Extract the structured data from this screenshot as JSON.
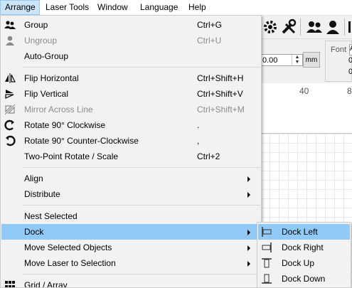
{
  "menubar": {
    "items": [
      {
        "label": "Arrange"
      },
      {
        "label": "Laser Tools"
      },
      {
        "label": "Window"
      },
      {
        "label": "Language"
      },
      {
        "label": "Help"
      }
    ]
  },
  "arrange_menu": {
    "items": [
      {
        "label": "Group",
        "shortcut": "Ctrl+G",
        "icon": "group-icon"
      },
      {
        "label": "Ungroup",
        "shortcut": "Ctrl+U",
        "icon": "ungroup-icon",
        "disabled": true
      },
      {
        "label": "Auto-Group",
        "shortcut": ""
      },
      {
        "label": "Flip Horizontal",
        "shortcut": "Ctrl+Shift+H",
        "icon": "flip-horizontal-icon"
      },
      {
        "label": "Flip Vertical",
        "shortcut": "Ctrl+Shift+V",
        "icon": "flip-vertical-icon"
      },
      {
        "label": "Mirror Across Line",
        "shortcut": "Ctrl+Shift+M",
        "icon": "mirror-line-icon",
        "disabled": true
      },
      {
        "label": "Rotate 90° Clockwise",
        "shortcut": ".",
        "icon": "rotate-cw-icon"
      },
      {
        "label": "Rotate 90° Counter-Clockwise",
        "shortcut": ",",
        "icon": "rotate-ccw-icon"
      },
      {
        "label": "Two-Point Rotate / Scale",
        "shortcut": "Ctrl+2"
      },
      {
        "label": "Align",
        "submenu": true
      },
      {
        "label": "Distribute",
        "submenu": true
      },
      {
        "label": "Nest Selected"
      },
      {
        "label": "Dock",
        "submenu": true,
        "highlighted": true
      },
      {
        "label": "Move Selected Objects",
        "submenu": true
      },
      {
        "label": "Move Laser to Selection",
        "submenu": true
      },
      {
        "label": "Grid / Array",
        "icon": "grid-icon"
      }
    ]
  },
  "dock_submenu": {
    "items": [
      {
        "label": "Dock Left",
        "icon": "dock-left-icon",
        "highlighted": true
      },
      {
        "label": "Dock Right",
        "icon": "dock-right-icon"
      },
      {
        "label": "Dock Up",
        "icon": "dock-up-icon"
      },
      {
        "label": "Dock Down",
        "icon": "dock-down-icon"
      }
    ]
  },
  "background": {
    "numeric_value": "0.00",
    "unit_button": "mm",
    "font_label": "Font",
    "font_value": "A",
    "right_digits": [
      "0",
      "0"
    ],
    "ruler_labels": [
      "40",
      "8"
    ]
  },
  "colors": {
    "highlight": "#91c9f7",
    "menubar_active": "#cce4f7",
    "disabled_text": "#8c8c8c"
  }
}
